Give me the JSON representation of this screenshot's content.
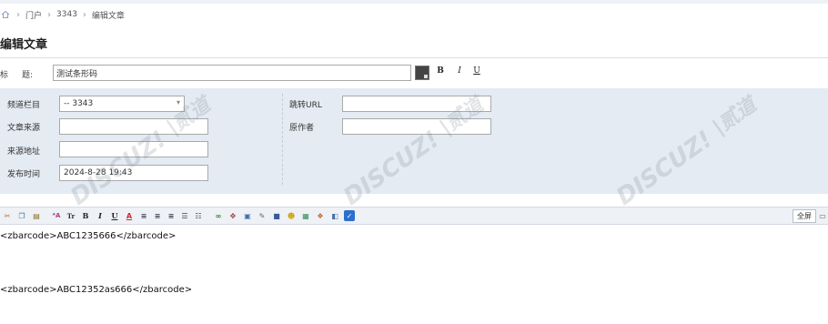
{
  "breadcrumb": {
    "items": [
      "门户",
      "3343",
      "编辑文章"
    ]
  },
  "page_title": "编辑文章",
  "title_field": {
    "label_part1": "标",
    "label_part2": "题:",
    "value": "测试条形码",
    "format_bold": "B",
    "format_italic": "I",
    "format_underline": "U"
  },
  "meta": {
    "category_label": "频道栏目",
    "category_value": "-- 3343",
    "source_label": "文章来源",
    "source_value": "",
    "source_url_label": "来源地址",
    "source_url_value": "",
    "publish_time_label": "发布时间",
    "publish_time_value": "2024-8-28 19:43",
    "redirect_url_label": "跳转URL",
    "redirect_url_value": "",
    "author_label": "原作者",
    "author_value": ""
  },
  "toolbar": {
    "fullscreen_label": "全屏"
  },
  "editor": {
    "lines": [
      "<zbarcode>ABC1235666</zbarcode>",
      "<zbarcode>ABC12352as666</zbarcode>"
    ]
  },
  "colors": {
    "panel_bg": "#e4ebf2",
    "toolbar_bg": "#eef1f5",
    "border": "#a9a9a9"
  }
}
